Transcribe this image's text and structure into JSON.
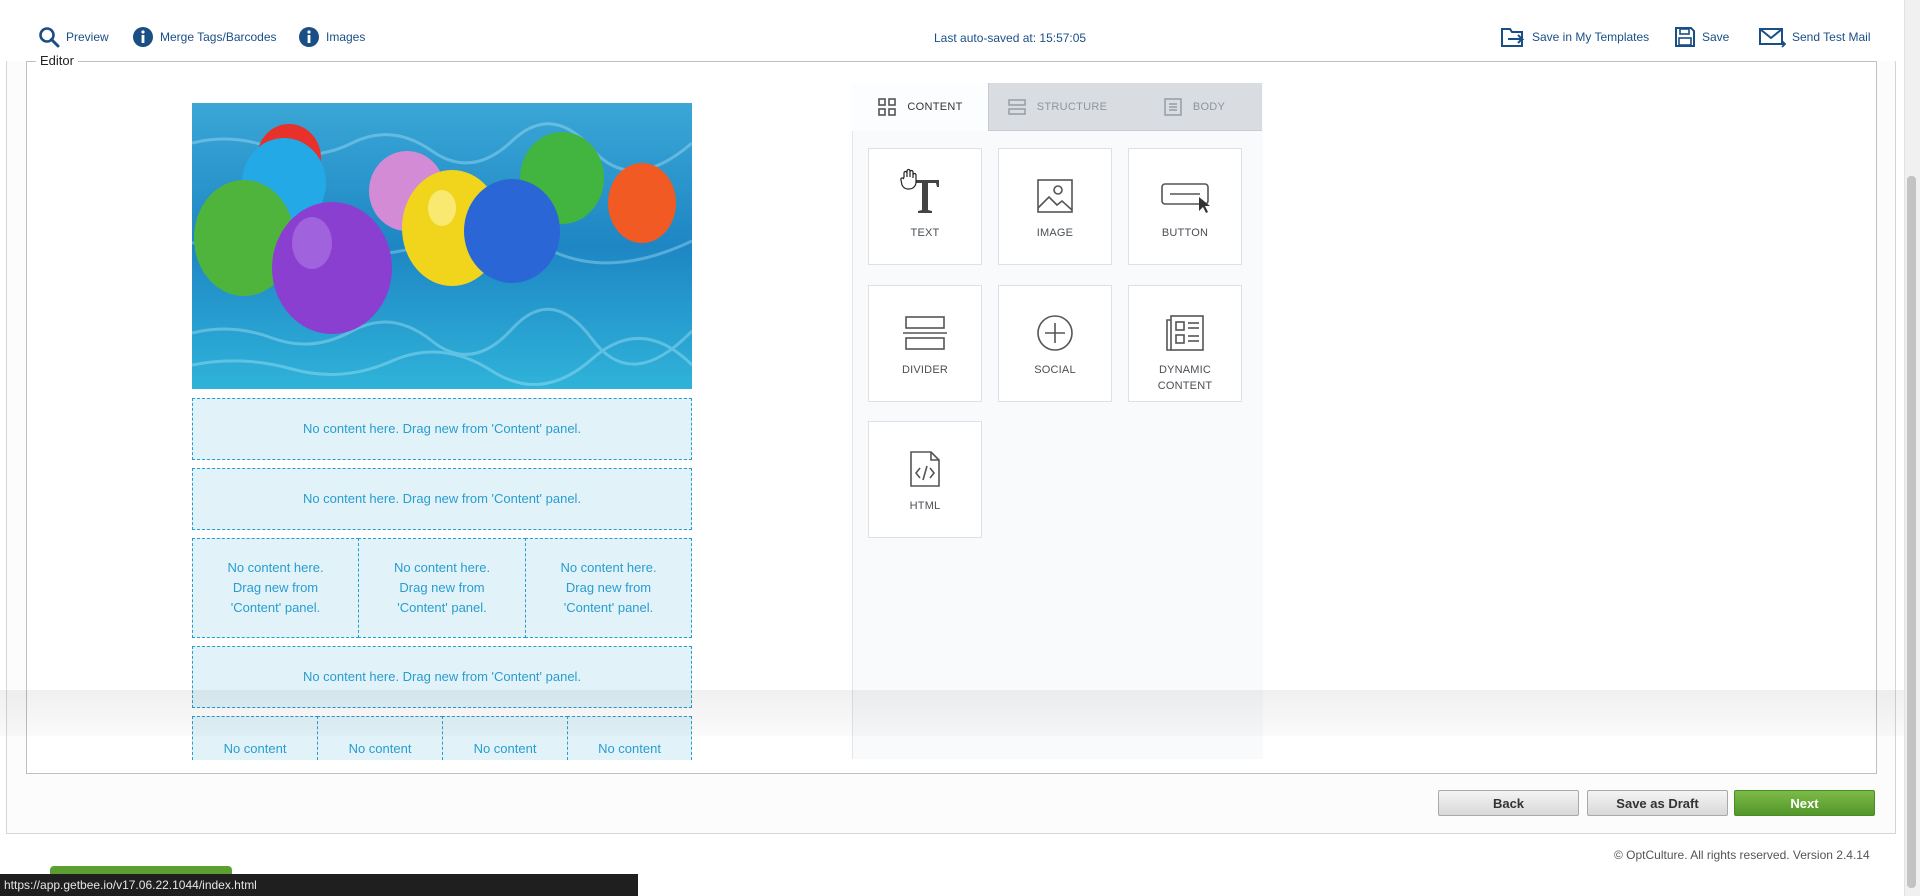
{
  "toolbar": {
    "preview": "Preview",
    "merge_tags": "Merge Tags/Barcodes",
    "images": "Images",
    "autosave": "Last auto-saved at: 15:57:05",
    "save_templates": "Save in My Templates",
    "save": "Save",
    "send_test": "Send Test Mail"
  },
  "editor": {
    "legend": "Editor",
    "placeholder_full": "No content here. Drag new from 'Content' panel.",
    "placeholder_col_1": "No content here.",
    "placeholder_col_2": "Drag new from",
    "placeholder_col_3": "'Content' panel.",
    "placeholder_short": "No content"
  },
  "panel": {
    "tabs": [
      {
        "label": "CONTENT",
        "icon": "grid-icon"
      },
      {
        "label": "STRUCTURE",
        "icon": "rows-icon"
      },
      {
        "label": "BODY",
        "icon": "page-icon"
      }
    ],
    "tiles": [
      {
        "label": "TEXT",
        "icon": "text-icon"
      },
      {
        "label": "IMAGE",
        "icon": "image-icon"
      },
      {
        "label": "BUTTON",
        "icon": "button-icon"
      },
      {
        "label": "DIVIDER",
        "icon": "divider-icon"
      },
      {
        "label": "SOCIAL",
        "icon": "social-icon"
      },
      {
        "label": "DYNAMIC",
        "label2": "CONTENT",
        "icon": "dynamic-content-icon"
      },
      {
        "label": "HTML",
        "icon": "html-icon"
      }
    ]
  },
  "footer": {
    "back": "Back",
    "save_draft": "Save as Draft",
    "next": "Next",
    "copyright": "© OptCulture. All rights reserved. Version 2.4.14"
  },
  "statusbar": {
    "url": "https://app.getbee.io/v17.06.22.1044/index.html"
  },
  "colors": {
    "link": "#1a4f86",
    "accent": "#2a9ccf",
    "placeholder_bg": "#e1f3f9",
    "next_green": "#5c9e31"
  }
}
